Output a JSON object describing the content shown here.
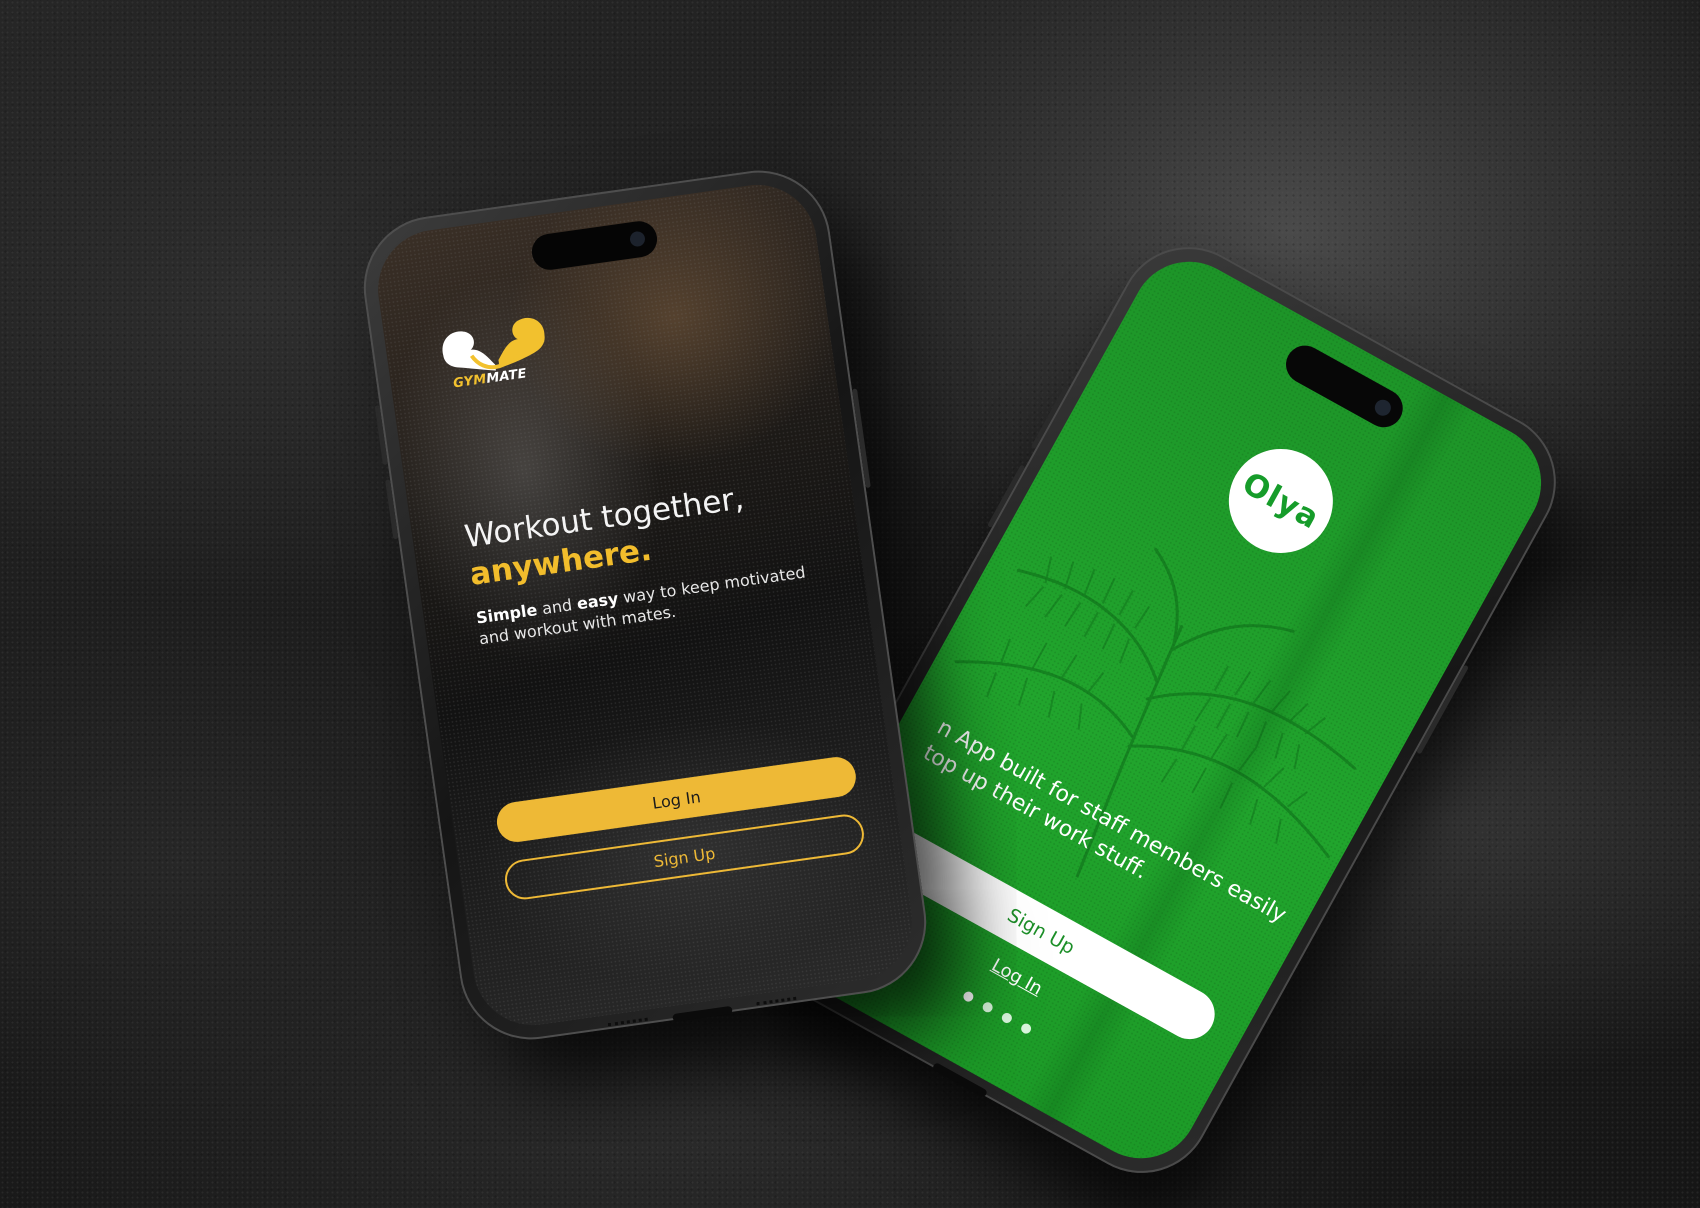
{
  "phones": {
    "gymmate": {
      "logo_prefix": "GYM",
      "logo_suffix": "MATE",
      "headline_line1": "Workout together,",
      "headline_accent": "anywhere.",
      "subtitle_simple": "Simple",
      "subtitle_and": " and ",
      "subtitle_easy": "easy",
      "subtitle_rest": " way to keep motivated and workout with mates.",
      "login_label": "Log In",
      "signup_label": "Sign Up",
      "accent_color": "#f2bd2c"
    },
    "olya": {
      "logo_text": "Olya",
      "tagline": "n App built for staff members easily top up their work stuff.",
      "signup_label": "Sign Up",
      "login_label": "Log In",
      "page_dots": 4,
      "active_dot": 1,
      "accent_color": "#21a52d"
    }
  }
}
